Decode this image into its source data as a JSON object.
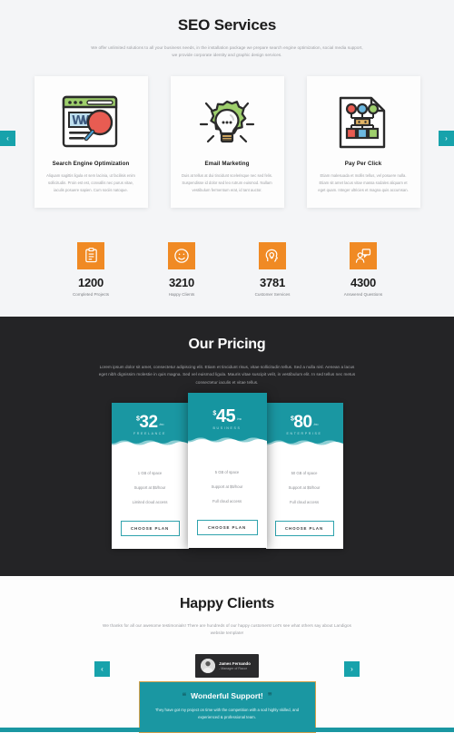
{
  "services": {
    "title": "SEO Services",
    "subtitle": "We offer unlimited solutions to all your business needs, in the installation package we prepare search engine optimization, social media support, we provide corporate identity and graphic design services.",
    "prev_arrow": "‹",
    "next_arrow": "›",
    "cards": [
      {
        "icon": "browser-search-icon",
        "title": "Search Engine Optimization",
        "text": "Aliquam sagittis ligula et sem lacinia, ut facilisis enim sollicitudin. Proin est est, convallis nec purus vitae, iaculis posuere sapien. Cum sociis natoque."
      },
      {
        "icon": "lightbulb-gear-icon",
        "title": "Email Marketing",
        "text": "Duis at tellus at dui tincidunt scelerisque nec sed felis. Suspendisse id dolor sed leo rutrum euismod. Nullam vestibulum fermentum erat, id tant auctor."
      },
      {
        "icon": "flowchart-document-icon",
        "title": "Pay Per Click",
        "text": "Etiam malesuada et mollis tellus, vel posuere nulla. Etiam sit amet lacus vitae massa sodales aliquam et eget quam. Integer ultricies et magna quis accumsan."
      }
    ]
  },
  "stats": [
    {
      "icon": "clipboard-icon",
      "number": "1200",
      "label": "Completed Projects"
    },
    {
      "icon": "smiley-icon",
      "number": "3210",
      "label": "Happy Clients"
    },
    {
      "icon": "head-idea-icon",
      "number": "3781",
      "label": "Customer Services"
    },
    {
      "icon": "chat-user-icon",
      "number": "4300",
      "label": "Answered Questions"
    }
  ],
  "pricing": {
    "title": "Our Pricing",
    "subtitle": "Lorem ipsum dolor sit amet, consectetur adipiscing elit. Etiam et tincidunt risus, vitae sollicitudin tellus. Sed a nulla nisl. Aenean a lacus eget nibh dignissim molestie in quis magna. Sed vel euismod ligula. Mauris vitae suscipit velit, in vestibulum elit. In sed tellus nec metus consectetur iaculis et vitae tellus.",
    "plans": [
      {
        "currency": "$",
        "price": "32",
        "per": "/mo",
        "name": "FREELANCE",
        "features": [
          "1 GB of space",
          "Support at $5/hour",
          "Limited cloud access"
        ],
        "button": "CHOOSE PLAN"
      },
      {
        "currency": "$",
        "price": "45",
        "per": "/mo",
        "name": "BUSINESS",
        "features": [
          "5 GB of space",
          "Support at $5/hour",
          "Full cloud access"
        ],
        "button": "CHOOSE PLAN"
      },
      {
        "currency": "$",
        "price": "80",
        "per": "/mo",
        "name": "ENTERPRISE",
        "features": [
          "50 GB of space",
          "Support at $5/hour",
          "Full cloud access"
        ],
        "button": "CHOOSE PLAN"
      }
    ]
  },
  "clients": {
    "title": "Happy Clients",
    "subtitle": "We thanks for all our awesome testimonials! There are hundreds of our happy customers! Let's see what others say about Landigos website template!",
    "prev_arrow": "‹",
    "next_arrow": "›",
    "testimonial": {
      "author": "James Fernando",
      "role": "- Manager of Racor",
      "quote_open": "❝",
      "quote_close": "❞",
      "heading": "Wonderful Support!",
      "body": "They have got my project on time with the competition with a sod highly skilled, and experienced & professional team."
    }
  },
  "colors": {
    "teal": "#1a97a2",
    "orange": "#f08a24",
    "dark": "#242426",
    "light_bg": "#f4f5f7",
    "gold_border": "#d3a04a"
  }
}
